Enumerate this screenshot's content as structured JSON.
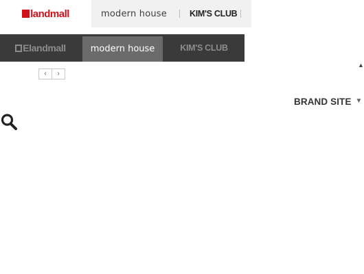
{
  "top_bar": {
    "logo_e": "E",
    "logo_text": "landmall",
    "brands": [
      "modern house",
      "KIM'S CLUB"
    ]
  },
  "nav_bar": {
    "eland_label": "Elandmall",
    "tabs": [
      "modern house",
      "KIM'S CLUB"
    ],
    "active_tab": "modern house"
  },
  "pager": {
    "prev": "‹",
    "next": "›"
  },
  "brand_site": {
    "label": "BRAND SITE",
    "caret": "▼"
  },
  "scroll_top": {
    "caret": "▲"
  },
  "colors": {
    "brand_red": "#d0121b",
    "nav_bg": "#3a3a3a",
    "nav_active_bg": "#6b6b6b",
    "top_brands_bg": "#f1f1f1"
  },
  "icons": {
    "search": "search-icon"
  }
}
